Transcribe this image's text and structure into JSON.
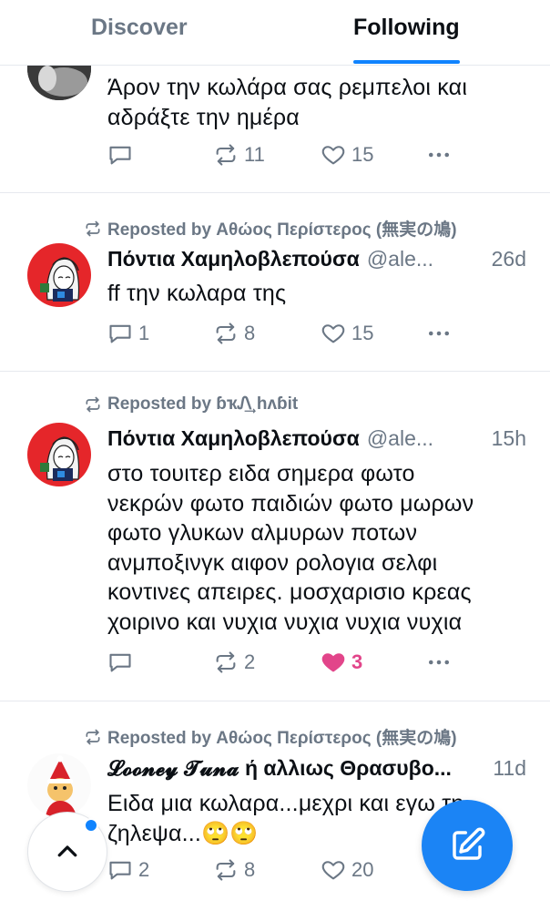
{
  "tabs": {
    "discover": "Discover",
    "following": "Following"
  },
  "posts": [
    {
      "text": "Άρον την κωλάρα σας ρεμπελοι και\nαδράξτε την ημέρα",
      "reply_count": "",
      "repost_count": "11",
      "like_count": "15"
    },
    {
      "repost_by": "Reposted by Αθώος Περίστερος (無実の鳩)",
      "author_name": "Πόντια Χαμηλοβλεπούσα",
      "author_handle": "@ale...",
      "time": "26d",
      "text": "ff την κωλαρα της",
      "reply_count": "1",
      "repost_count": "8",
      "like_count": "15"
    },
    {
      "repost_by": "Reposted by ɓҡᏁ͢ hʌɓit",
      "author_name": "Πόντια Χαμηλοβλεπούσα",
      "author_handle": "@ale...",
      "time": "15h",
      "text": "στο τουιτερ ειδα σημερα φωτο\nνεκρών φωτο παιδιών φωτο μωρων\nφωτο γλυκων αλμυρων ποτων\nανμποξινγκ αιφον ρολογια σελφι\nκοντινες απειρες. μοσχαρισιο κρεας\nχοιρινο και νυχια νυχια νυχια νυχια",
      "reply_count": "",
      "repost_count": "2",
      "like_count": "3",
      "liked": true
    },
    {
      "repost_by": "Reposted by Αθώος Περίστερος (無実の鳩)",
      "author_name": "𝓛𝓸𝓸𝓷𝓮𝔂 𝓣𝓾𝓷𝓪 ή αλλιως Θρασυβο...",
      "time": "11d",
      "text": "Ειδα μια κωλαρα...μεχρι και εγω τη\nζηλεψα...🙄🙄",
      "reply_count": "2",
      "repost_count": "8",
      "like_count": "20"
    }
  ],
  "colors": {
    "accent": "#1083fe",
    "muted": "#6b7785",
    "like_active": "#e2458a",
    "fab": "#1b84f5"
  },
  "icons": {
    "reply": "reply-icon",
    "repost": "repost-icon",
    "like": "heart-icon",
    "more": "more-icon",
    "scroll_top": "chevron-up-icon",
    "compose": "compose-icon"
  }
}
